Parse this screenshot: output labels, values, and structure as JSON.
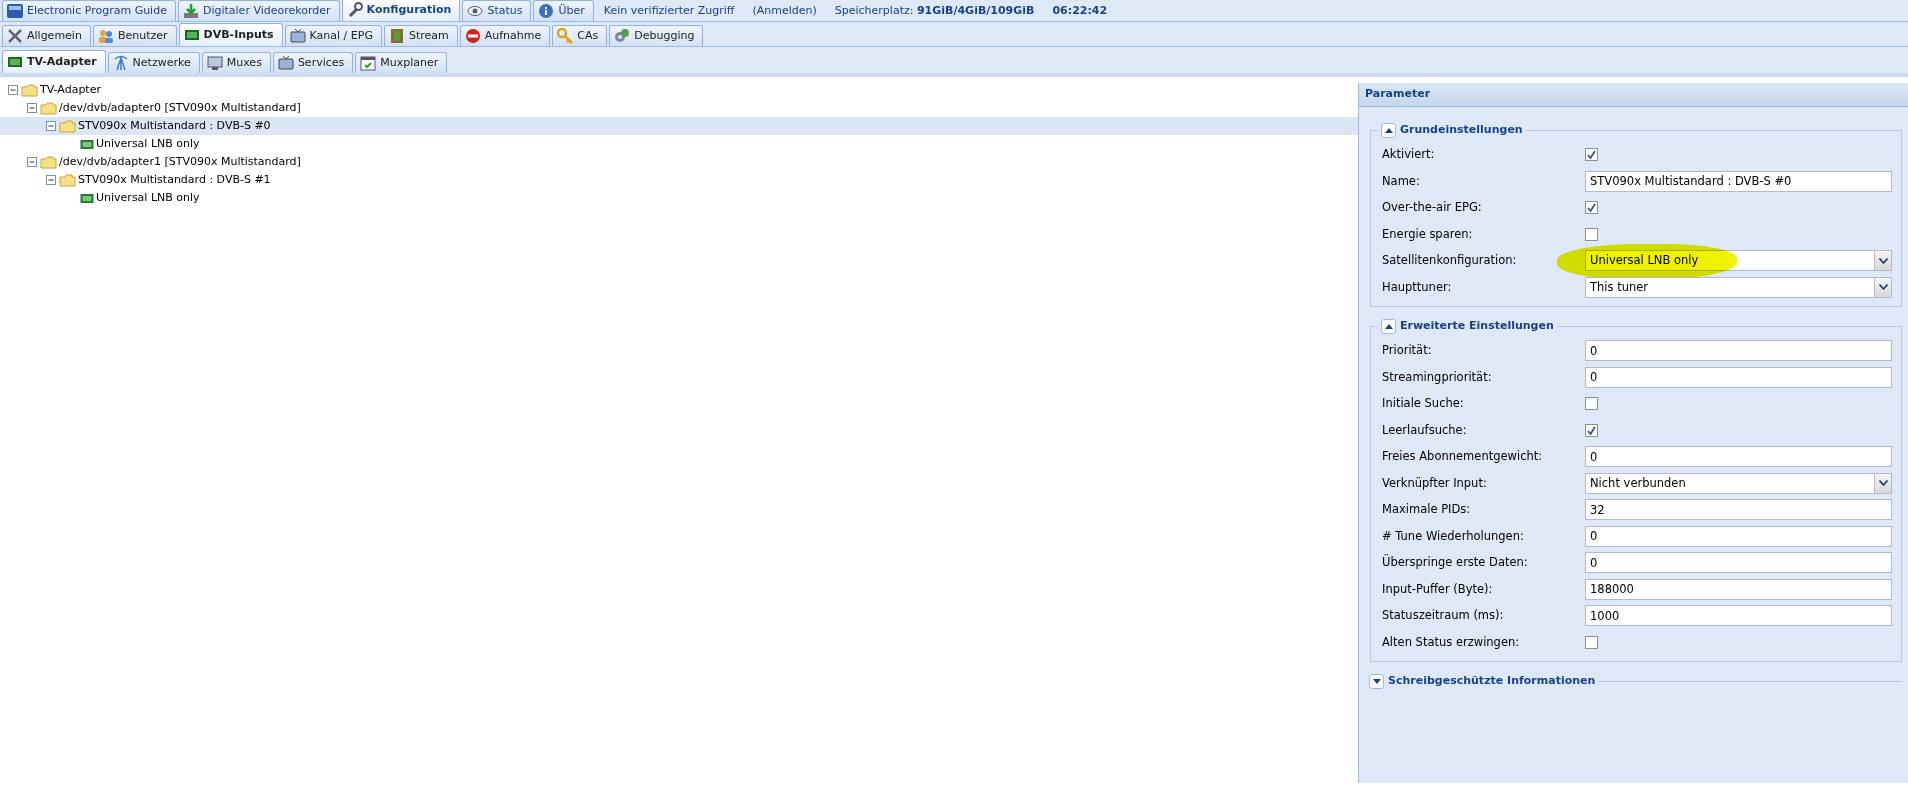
{
  "top_tabs": [
    {
      "label": "Electronic Program Guide",
      "selected": false
    },
    {
      "label": "Digitaler Videorekorder",
      "selected": false
    },
    {
      "label": "Konfiguration",
      "selected": true
    },
    {
      "label": "Status",
      "selected": false
    },
    {
      "label": "Über",
      "selected": false
    }
  ],
  "status_info": {
    "access": "Kein verifizierter Zugriff",
    "login": "(Anmelden)",
    "storage": "Speicherplatz: **91GiB/4GiB/109GiB**",
    "time": "06:22:42"
  },
  "sub_tabs": [
    {
      "label": "Allgemein",
      "selected": false
    },
    {
      "label": "Benutzer",
      "selected": false
    },
    {
      "label": "DVB-Inputs",
      "selected": true
    },
    {
      "label": "Kanal / EPG",
      "selected": false
    },
    {
      "label": "Stream",
      "selected": false
    },
    {
      "label": "Aufnahme",
      "selected": false
    },
    {
      "label": "CAs",
      "selected": false
    },
    {
      "label": "Debugging",
      "selected": false
    }
  ],
  "inner_tabs": [
    {
      "label": "TV-Adapter",
      "selected": true
    },
    {
      "label": "Netzwerke",
      "selected": false
    },
    {
      "label": "Muxes",
      "selected": false
    },
    {
      "label": "Services",
      "selected": false
    },
    {
      "label": "Muxplaner",
      "selected": false
    }
  ],
  "tree": [
    {
      "label": "TV-Adapter",
      "kind": "folder",
      "expanded": true,
      "selected": false,
      "children": [
        {
          "label": "/dev/dvb/adapter0 [STV090x Multistandard]",
          "kind": "folder",
          "expanded": true,
          "selected": false,
          "children": [
            {
              "label": "STV090x Multistandard : DVB-S #0",
              "kind": "folder",
              "expanded": true,
              "selected": true,
              "children": [
                {
                  "label": "Universal LNB only",
                  "kind": "device",
                  "selected": false
                }
              ]
            }
          ]
        },
        {
          "label": "/dev/dvb/adapter1 [STV090x Multistandard]",
          "kind": "folder",
          "expanded": true,
          "selected": false,
          "children": [
            {
              "label": "STV090x Multistandard : DVB-S #1",
              "kind": "folder",
              "expanded": true,
              "selected": false,
              "children": [
                {
                  "label": "Universal LNB only",
                  "kind": "device",
                  "selected": false
                }
              ]
            }
          ]
        }
      ]
    }
  ],
  "panel": {
    "title": "Parameter",
    "sections": [
      {
        "title": "Grundeinstellungen",
        "expanded": true,
        "fields": [
          {
            "label": "Aktiviert:",
            "kind": "checkbox",
            "checked": true
          },
          {
            "label": "Name:",
            "kind": "text",
            "value": "STV090x Multistandard : DVB-S #0"
          },
          {
            "label": "Over-the-air EPG:",
            "kind": "checkbox",
            "checked": true
          },
          {
            "label": "Energie sparen:",
            "kind": "checkbox",
            "checked": false
          },
          {
            "label": "Satellitenkonfiguration:",
            "kind": "select",
            "value": "Universal LNB only",
            "highlighted": true
          },
          {
            "label": "Haupttuner:",
            "kind": "select",
            "value": "This tuner"
          }
        ]
      },
      {
        "title": "Erweiterte Einstellungen",
        "expanded": true,
        "fields": [
          {
            "label": "Priorität:",
            "kind": "text",
            "value": "0"
          },
          {
            "label": "Streamingpriorität:",
            "kind": "text",
            "value": "0"
          },
          {
            "label": "Initiale Suche:",
            "kind": "checkbox",
            "checked": false
          },
          {
            "label": "Leerlaufsuche:",
            "kind": "checkbox",
            "checked": true
          },
          {
            "label": "Freies Abonnementgewicht:",
            "kind": "text",
            "value": "0"
          },
          {
            "label": "Verknüpfter Input:",
            "kind": "select",
            "value": "Nicht verbunden"
          },
          {
            "label": "Maximale PIDs:",
            "kind": "text",
            "value": "32"
          },
          {
            "label": "# Tune Wiederholungen:",
            "kind": "text",
            "value": "0"
          },
          {
            "label": "Überspringe erste Daten:",
            "kind": "text",
            "value": "0"
          },
          {
            "label": "Input-Puffer (Byte):",
            "kind": "text",
            "value": "188000"
          },
          {
            "label": "Statuszeitraum (ms):",
            "kind": "text",
            "value": "1000"
          },
          {
            "label": "Alten Status erzwingen:",
            "kind": "checkbox",
            "checked": false
          }
        ]
      },
      {
        "title": "Schreibgeschützte Informationen",
        "expanded": false
      }
    ]
  }
}
